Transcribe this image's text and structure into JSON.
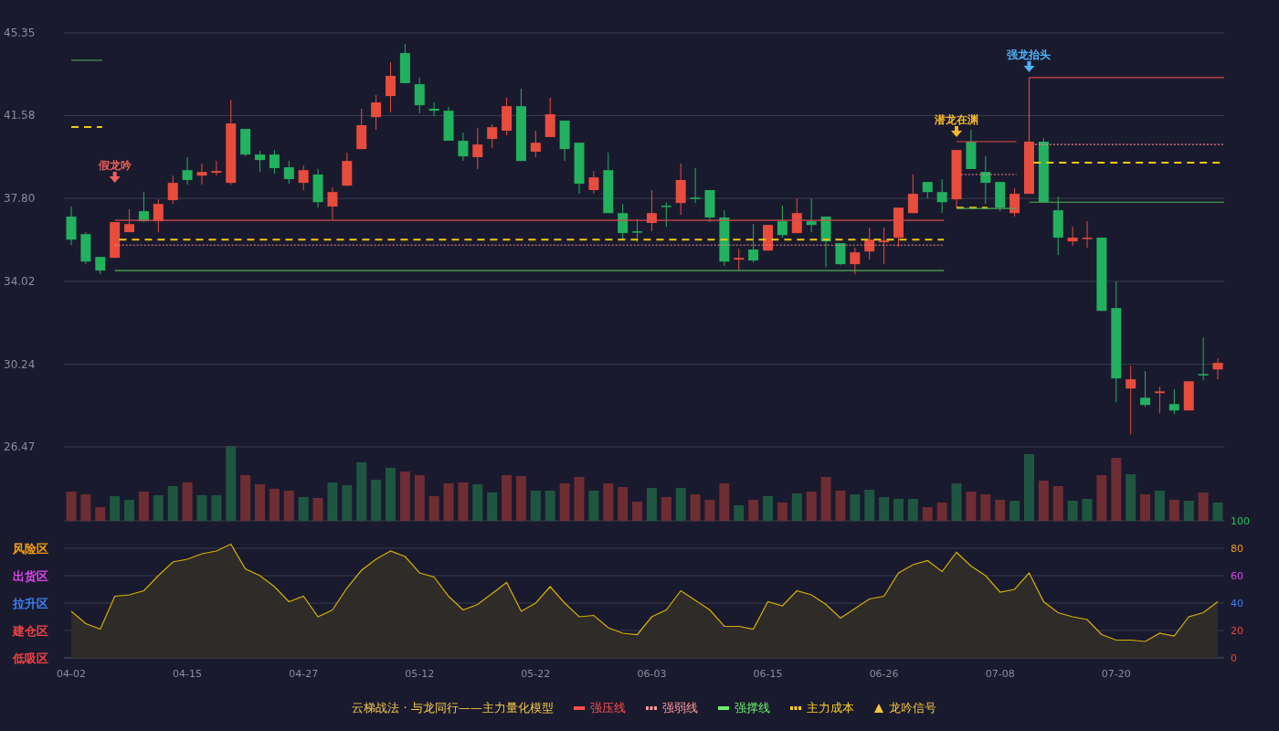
{
  "price_chart": {
    "chart_data": {
      "type": "candlestick",
      "grid": true,
      "categories": [
        null,
        null,
        null,
        null,
        null,
        null,
        null,
        null,
        null,
        null,
        null,
        null,
        null,
        null,
        null,
        null,
        null,
        null,
        null,
        null,
        null,
        null,
        null,
        null,
        null,
        null,
        null,
        null,
        null,
        null,
        null,
        null,
        null,
        null,
        null,
        null,
        null,
        null,
        null,
        null,
        null,
        null,
        null,
        null,
        null,
        null,
        null,
        null,
        null,
        null,
        null,
        null,
        null,
        null,
        null,
        null,
        null,
        null,
        null,
        null,
        null,
        null,
        null,
        null,
        null,
        null,
        null,
        null,
        null,
        null,
        null,
        null,
        null,
        null,
        null,
        null,
        null,
        null,
        null,
        null
      ],
      "ylim": [
        26.47,
        45.35
      ],
      "yticks": [
        {
          "value": 45.35,
          "label": "45.35"
        },
        {
          "value": 41.58,
          "label": "41.58"
        },
        {
          "value": 37.8,
          "label": "37.80"
        },
        {
          "value": 34.02,
          "label": "34.02"
        },
        {
          "value": 30.24,
          "label": "30.24"
        },
        {
          "value": 26.47,
          "label": "26.47"
        }
      ],
      "ohlc": [
        [
          36.97,
          37.43,
          35.67,
          35.92
        ],
        [
          36.17,
          36.26,
          34.8,
          34.92
        ],
        [
          35.13,
          35.13,
          34.34,
          34.51
        ],
        [
          35.09,
          36.72,
          35.09,
          36.72
        ],
        [
          36.26,
          37.3,
          36.26,
          36.63
        ],
        [
          37.22,
          38.09,
          36.72,
          36.76
        ],
        [
          36.76,
          37.76,
          36.26,
          37.55
        ],
        [
          37.72,
          38.84,
          37.55,
          38.51
        ],
        [
          39.09,
          39.68,
          38.43,
          38.64
        ],
        [
          38.84,
          39.39,
          38.43,
          39.01
        ],
        [
          38.97,
          39.51,
          38.84,
          39.05
        ],
        [
          38.51,
          42.3,
          38.43,
          41.22
        ],
        [
          40.97,
          40.97,
          39.72,
          39.8
        ],
        [
          39.8,
          39.97,
          39.01,
          39.55
        ],
        [
          39.8,
          40.01,
          38.93,
          39.18
        ],
        [
          39.22,
          39.51,
          38.47,
          38.68
        ],
        [
          38.51,
          39.3,
          38.18,
          39.09
        ],
        [
          38.89,
          39.14,
          37.38,
          37.63
        ],
        [
          37.43,
          38.3,
          36.84,
          38.09
        ],
        [
          38.38,
          39.89,
          38.38,
          39.51
        ],
        [
          40.05,
          41.89,
          40.05,
          41.14
        ],
        [
          41.51,
          42.51,
          40.93,
          42.18
        ],
        [
          42.47,
          44.01,
          41.72,
          43.39
        ],
        [
          44.43,
          44.85,
          43.06,
          43.06
        ],
        [
          43.01,
          43.31,
          41.68,
          42.05
        ],
        [
          41.89,
          42.18,
          41.55,
          41.8
        ],
        [
          41.8,
          41.97,
          40.43,
          40.43
        ],
        [
          40.43,
          40.8,
          39.51,
          39.72
        ],
        [
          39.68,
          41.01,
          39.14,
          40.26
        ],
        [
          40.51,
          41.18,
          40.09,
          41.05
        ],
        [
          40.89,
          42.39,
          40.68,
          42.01
        ],
        [
          42.01,
          42.8,
          39.51,
          39.51
        ],
        [
          39.93,
          40.89,
          39.68,
          40.34
        ],
        [
          40.6,
          42.39,
          40.6,
          41.64
        ],
        [
          41.35,
          41.35,
          39.51,
          40.05
        ],
        [
          40.34,
          40.34,
          38.01,
          38.47
        ],
        [
          38.18,
          39.05,
          38.01,
          38.76
        ],
        [
          39.09,
          39.89,
          37.13,
          37.13
        ],
        [
          37.13,
          37.55,
          35.88,
          36.22
        ],
        [
          36.3,
          36.84,
          35.8,
          36.26
        ],
        [
          36.68,
          38.18,
          36.3,
          37.13
        ],
        [
          37.47,
          37.63,
          36.51,
          37.43
        ],
        [
          37.59,
          39.39,
          37.05,
          38.64
        ],
        [
          37.84,
          39.18,
          37.59,
          37.8
        ],
        [
          38.18,
          38.18,
          36.72,
          36.93
        ],
        [
          36.93,
          37.26,
          34.72,
          34.92
        ],
        [
          35.01,
          35.51,
          34.55,
          35.09
        ],
        [
          35.47,
          36.63,
          34.88,
          34.97
        ],
        [
          35.42,
          36.59,
          35.42,
          36.59
        ],
        [
          36.76,
          37.47,
          36.01,
          36.13
        ],
        [
          36.22,
          37.8,
          36.22,
          37.13
        ],
        [
          36.76,
          37.8,
          36.26,
          36.59
        ],
        [
          36.97,
          36.97,
          34.67,
          35.84
        ],
        [
          35.76,
          35.76,
          34.76,
          34.8
        ],
        [
          34.8,
          35.55,
          34.34,
          35.34
        ],
        [
          35.38,
          36.47,
          35.01,
          35.92
        ],
        [
          35.8,
          36.47,
          34.8,
          35.88
        ],
        [
          36.01,
          37.38,
          35.59,
          37.38
        ],
        [
          37.13,
          38.89,
          37.13,
          38.01
        ],
        [
          38.55,
          38.55,
          37.8,
          38.09
        ],
        [
          38.09,
          38.68,
          37.13,
          37.63
        ],
        [
          37.76,
          40.01,
          37.38,
          40.01
        ],
        [
          40.39,
          40.93,
          39.14,
          39.14
        ],
        [
          39.01,
          39.72,
          37.55,
          38.51
        ],
        [
          38.55,
          38.55,
          37.22,
          37.38
        ],
        [
          37.13,
          38.26,
          36.97,
          38.01
        ],
        [
          38.01,
          40.39,
          38.01,
          40.39
        ],
        [
          40.39,
          40.55,
          37.63,
          37.63
        ],
        [
          37.26,
          37.88,
          35.22,
          36.01
        ],
        [
          35.84,
          36.51,
          35.63,
          36.01
        ],
        [
          35.97,
          36.76,
          35.55,
          36.01
        ],
        [
          36.01,
          36.01,
          32.67,
          32.67
        ],
        [
          32.8,
          34.01,
          28.5,
          29.59
        ],
        [
          29.13,
          30.17,
          27.04,
          29.55
        ],
        [
          28.71,
          29.92,
          28.29,
          28.38
        ],
        [
          28.92,
          29.21,
          28.0,
          29.0
        ],
        [
          28.42,
          29.09,
          27.96,
          28.13
        ],
        [
          28.13,
          29.46,
          28.13,
          29.46
        ],
        [
          29.79,
          31.46,
          29.5,
          29.75
        ],
        [
          30.0,
          30.5,
          29.55,
          30.3
        ]
      ]
    },
    "signals": [
      {
        "text": "假龙吟",
        "color": "#f0605a"
      },
      {
        "text": "潜龙在渊",
        "color": "#f5b82e"
      },
      {
        "text": "强龙抬头",
        "color": "#4fb3f6"
      }
    ]
  },
  "oscillator": {
    "zones": [
      {
        "label": "风险区",
        "color": "#f59e0b"
      },
      {
        "label": "出货区",
        "color": "#d946ef"
      },
      {
        "label": "拉升区",
        "color": "#3b82f6"
      },
      {
        "label": "建仓区",
        "color": "#ef4444"
      },
      {
        "label": "低吸区",
        "color": "#ef4444"
      }
    ],
    "chart_data": {
      "type": "area",
      "grid": true,
      "ylim": [
        0,
        100
      ],
      "yticks": [
        0,
        20,
        40,
        60,
        80,
        100
      ],
      "categories": [
        "04-02",
        null,
        null,
        null,
        null,
        null,
        null,
        null,
        "04-15",
        null,
        null,
        null,
        null,
        null,
        null,
        null,
        "04-27",
        null,
        null,
        null,
        null,
        null,
        null,
        null,
        "05-12",
        null,
        null,
        null,
        null,
        null,
        null,
        null,
        "05-22",
        null,
        null,
        null,
        null,
        null,
        null,
        null,
        "06-03",
        null,
        null,
        null,
        null,
        null,
        null,
        null,
        "06-15",
        null,
        null,
        null,
        null,
        null,
        null,
        null,
        "06-26",
        null,
        null,
        null,
        null,
        null,
        null,
        null,
        "07-08",
        null,
        null,
        null,
        null,
        null,
        null,
        null,
        "07-20",
        null,
        null,
        null,
        null,
        null,
        null,
        null
      ],
      "series": [
        {
          "color": "#d4b106",
          "values": [
            34,
            25,
            21,
            45,
            46,
            49,
            60,
            70,
            72,
            76,
            78,
            83,
            65,
            60,
            52,
            41,
            45,
            30,
            35,
            51,
            64,
            72,
            78,
            74,
            62,
            59,
            45,
            35,
            39,
            47,
            55,
            34,
            40,
            52,
            40,
            30,
            31,
            22,
            18,
            17,
            30,
            35,
            49,
            42,
            35,
            23,
            23,
            21,
            41,
            38,
            49,
            46,
            39,
            29,
            36,
            43,
            45,
            62,
            68,
            71,
            63,
            77,
            67,
            60,
            48,
            50,
            62,
            41,
            33,
            30,
            28,
            17,
            13,
            13,
            12,
            18,
            16,
            30,
            33,
            41
          ]
        }
      ]
    }
  },
  "legend": {
    "title": "云梯战法 · 与龙同行——主力量化模型",
    "items": [
      {
        "label": "强压线",
        "kind": "solid",
        "color": "#ff4d4d"
      },
      {
        "label": "强弱线",
        "kind": "dotted",
        "color": "#ff9a9a"
      },
      {
        "label": "强撑线",
        "kind": "solid",
        "color": "#6cf06c"
      },
      {
        "label": "主力成本",
        "kind": "dashed",
        "color": "#ffd21f"
      },
      {
        "label": "龙吟信号",
        "kind": "triangle",
        "color": "#f5c542"
      }
    ]
  }
}
